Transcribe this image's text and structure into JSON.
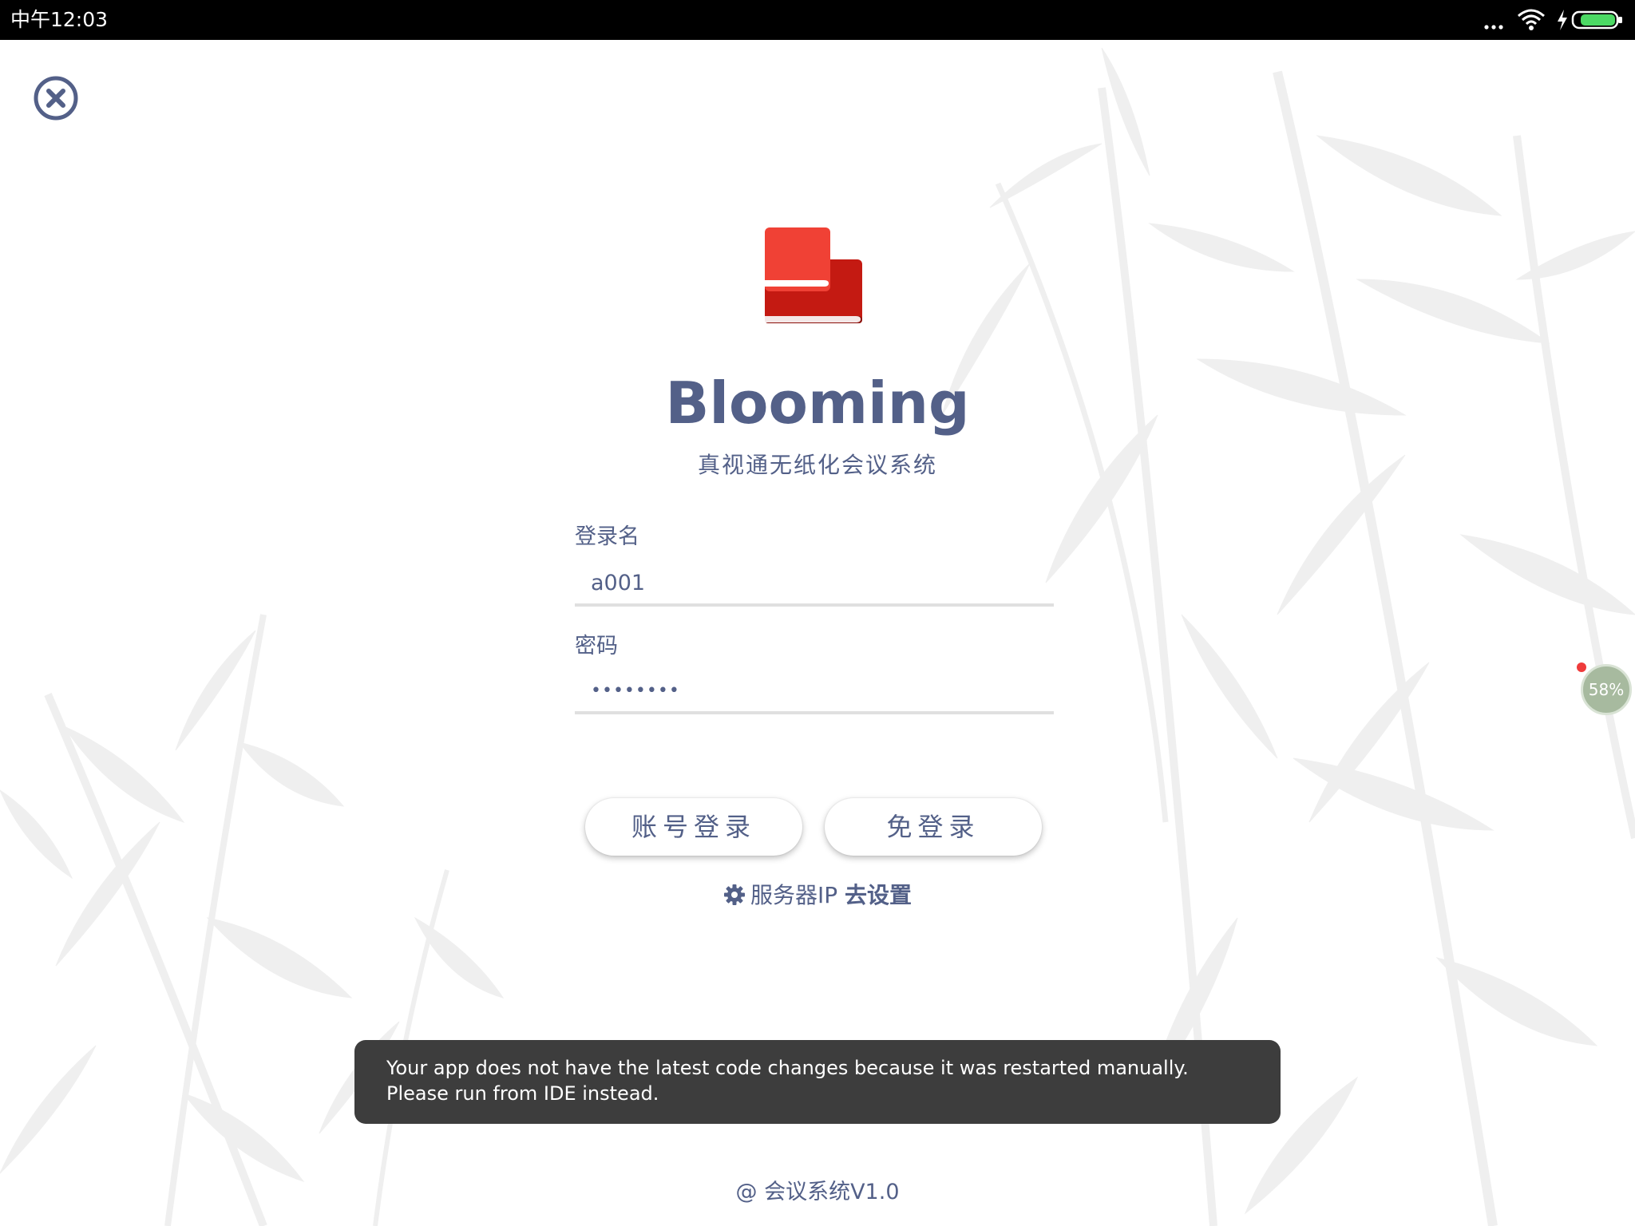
{
  "status_bar": {
    "time": "中午12:03",
    "icons": [
      "more-dots-icon",
      "wifi-icon",
      "charging-icon",
      "battery-icon"
    ]
  },
  "app": {
    "title": "Blooming",
    "subtitle": "真视通无纸化会议系统"
  },
  "login_form": {
    "username_label": "登录名",
    "username_value": "a001",
    "password_label": "密码",
    "password_value": "••••••••"
  },
  "buttons": {
    "account_login": "账号登录",
    "guest_login": "免登录"
  },
  "server": {
    "label": "服务器IP",
    "link": "去设置"
  },
  "toast": {
    "message": "Your app does not have the latest code changes because it was restarted manually. Please run from IDE instead."
  },
  "perf_badge": {
    "value": "58%"
  },
  "footer": {
    "text": "@ 会议系统V1.0"
  },
  "colors": {
    "accent": "#536088",
    "logo_red": "#f04135",
    "logo_dark_red": "#c41a12",
    "toast_bg": "#3d3d3d"
  }
}
